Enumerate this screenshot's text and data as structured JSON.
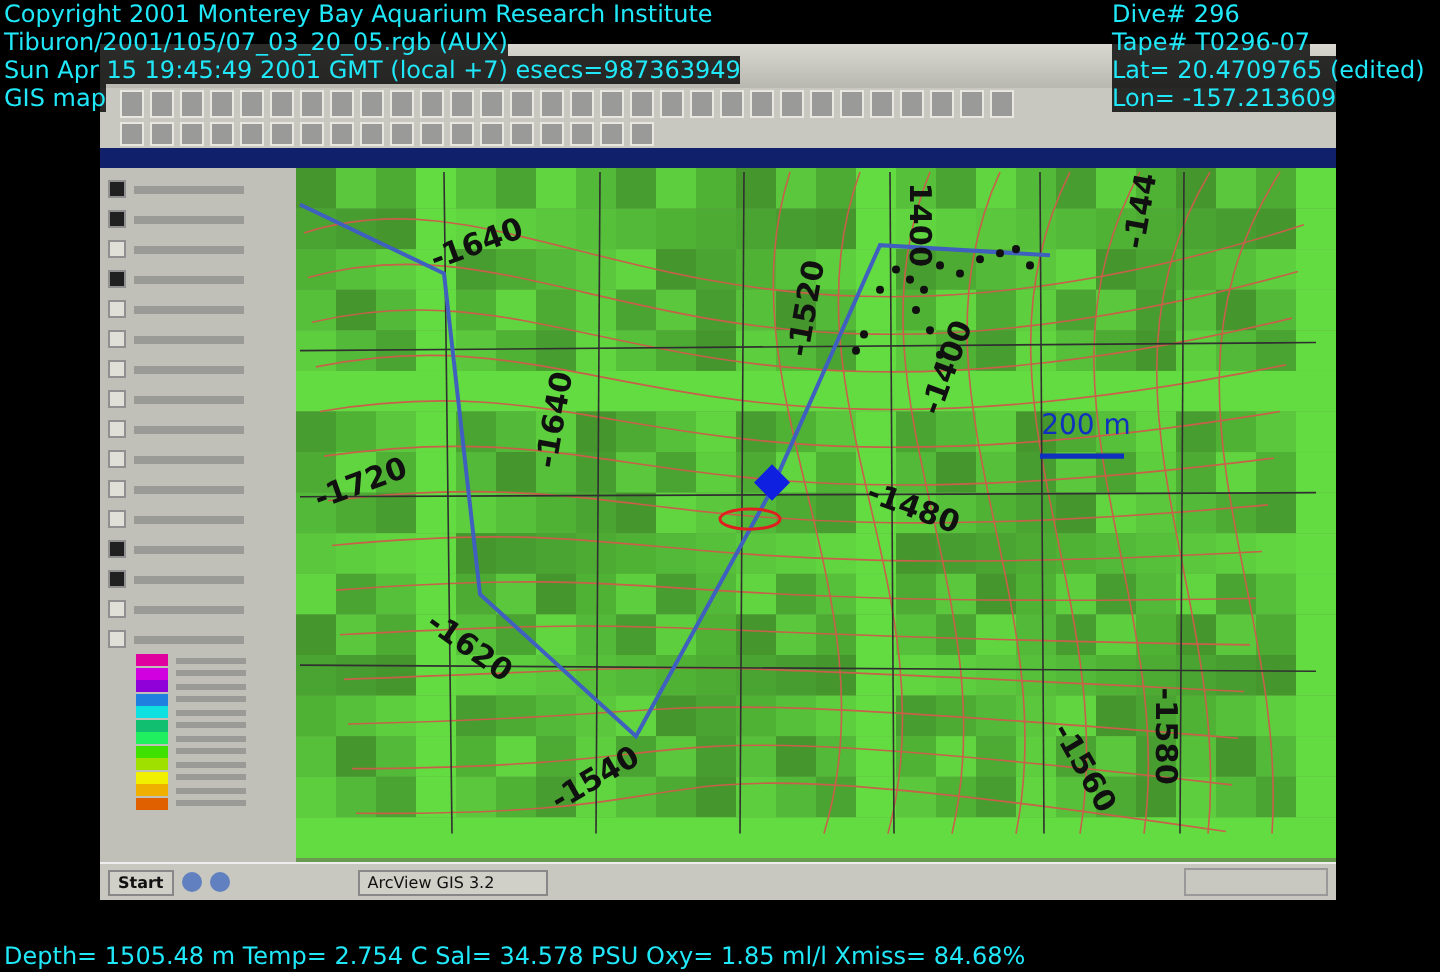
{
  "overlay_top_left": [
    "Copyright 2001 Monterey Bay Aquarium Research Institute",
    "Tiburon/2001/105/07_03_20_05.rgb (AUX)",
    "Sun Apr 15 19:45:49 2001 GMT (local +7)  esecs=987363949",
    "GIS map"
  ],
  "overlay_top_right": [
    "Dive# 296",
    "Tape# T0296-07",
    "Lat= 20.4709765 (edited)",
    "Lon= -157.213609"
  ],
  "layers": [
    {
      "checked": true
    },
    {
      "checked": true
    },
    {
      "checked": false
    },
    {
      "checked": true
    },
    {
      "checked": false
    },
    {
      "checked": false
    },
    {
      "checked": false
    },
    {
      "checked": false
    },
    {
      "checked": false
    },
    {
      "checked": false
    },
    {
      "checked": false
    },
    {
      "checked": false
    },
    {
      "checked": true
    },
    {
      "checked": true
    },
    {
      "checked": false
    },
    {
      "checked": false
    }
  ],
  "legend_swatches": [
    {
      "color": "#e000a0"
    },
    {
      "color": "#d000e0"
    },
    {
      "color": "#9000d8"
    },
    {
      "color": "#2080e0"
    },
    {
      "color": "#10e0e0"
    },
    {
      "color": "#10c070"
    },
    {
      "color": "#20f060"
    },
    {
      "color": "#40e000"
    },
    {
      "color": "#a0e000"
    },
    {
      "color": "#f0f000"
    },
    {
      "color": "#f0b000"
    },
    {
      "color": "#e06000"
    }
  ],
  "map": {
    "contour_labels": [
      "-1640",
      "1400",
      "-144",
      "-1520",
      "-1400",
      "-1720",
      "-1640",
      "-1480",
      "-1620",
      "-1540",
      "-1580",
      "-1560"
    ],
    "scale_bar": "200 m"
  },
  "taskbar": {
    "start": "Start",
    "task": "ArcView GIS 3.2"
  },
  "overlay_bottom": "Depth= 1505.48 m  Temp= 2.754 C  Sal= 34.578 PSU  Oxy= 1.85 ml/l  Xmiss= 84.68%"
}
